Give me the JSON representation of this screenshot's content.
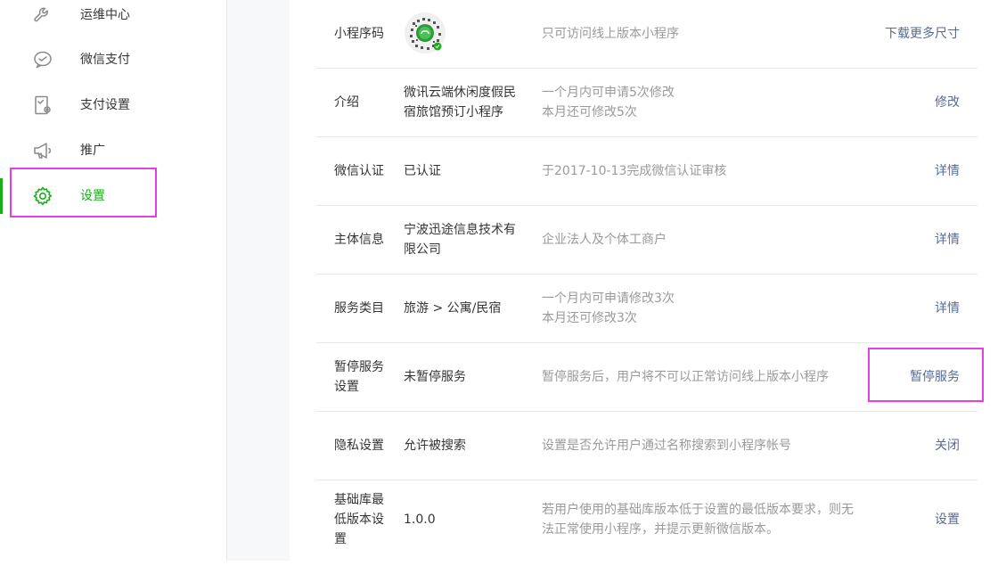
{
  "sidebar": {
    "items": [
      {
        "label": "运维中心",
        "icon": "wrench-icon"
      },
      {
        "label": "微信支付",
        "icon": "wechat-pay-icon"
      },
      {
        "label": "支付设置",
        "icon": "payment-settings-icon"
      },
      {
        "label": "推广",
        "icon": "megaphone-icon"
      },
      {
        "label": "设置",
        "icon": "gear-icon",
        "active": true
      }
    ]
  },
  "settings": {
    "rows": [
      {
        "label": "小程序码",
        "value": "",
        "desc": "只可访问线上版本小程序",
        "action": "下载更多尺寸"
      },
      {
        "label": "介绍",
        "value": "微讯云端休闲度假民宿旅馆预订小程序",
        "desc": "一个月内可申请5次修改\n本月还可修改5次",
        "action": "修改"
      },
      {
        "label": "微信认证",
        "value": "已认证",
        "desc": "于2017-10-13完成微信认证审核",
        "action": "详情"
      },
      {
        "label": "主体信息",
        "value": "宁波迅途信息技术有限公司",
        "desc": "企业法人及个体工商户",
        "action": "详情"
      },
      {
        "label": "服务类目",
        "value": "旅游 > 公寓/民宿",
        "desc": "一个月内可申请修改3次\n本月还可修改3次",
        "action": "详情"
      },
      {
        "label": "暂停服务设置",
        "value": "未暂停服务",
        "desc": "暂停服务后，用户将不可以正常访问线上版本小程序",
        "action": "暂停服务"
      },
      {
        "label": "隐私设置",
        "value": "允许被搜索",
        "desc": "设置是否允许用户通过名称搜索到小程序帐号",
        "action": "关闭"
      },
      {
        "label": "基础库最低版本设置",
        "value": "1.0.0",
        "desc": "若用户使用的基础库版本低于设置的最低版本要求，则无法正常使用小程序，并提示更新微信版本。",
        "action": "设置"
      }
    ]
  },
  "colors": {
    "accent": "#1aad19",
    "link": "#576b95",
    "highlight": "#e53fe0",
    "muted": "#9a9a9a"
  }
}
